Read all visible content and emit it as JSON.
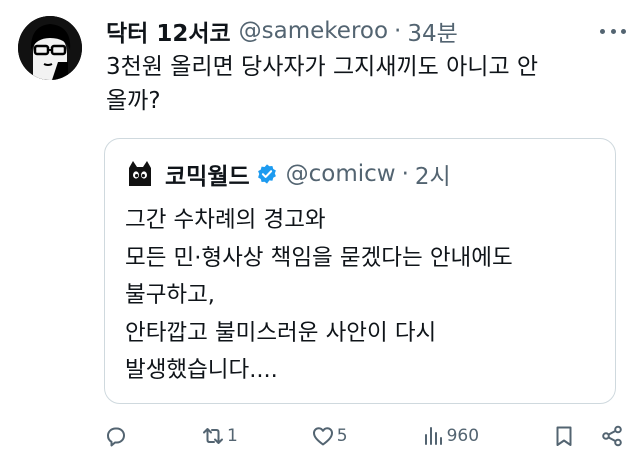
{
  "tweet": {
    "display_name": "닥터 12서코",
    "handle": "@samekeroo",
    "separator": "·",
    "time": "34분",
    "text": "3천원 올리면 당사자가 그지새끼도 아니고 안\n올까?"
  },
  "quote": {
    "display_name": "코믹월드",
    "handle": "@comicw",
    "separator": "·",
    "time": "2시",
    "text": "그간 수차례의 경고와\n모든 민·형사상 책임을 묻겠다는 안내에도\n불구하고,\n안타깝고 불미스러운 사안이 다시\n발생했습니다...."
  },
  "actions": {
    "reply_icon": "reply-icon",
    "retweet_icon": "retweet-icon",
    "retweet_count": "1",
    "like_icon": "heart-icon",
    "like_count": "5",
    "views_icon": "views-icon",
    "views_count": "960",
    "bookmark_icon": "bookmark-icon",
    "share_icon": "share-icon"
  },
  "colors": {
    "text": "#0f1419",
    "secondary": "#536471",
    "border": "#cfd9de",
    "verified": "#1d9bf0"
  }
}
